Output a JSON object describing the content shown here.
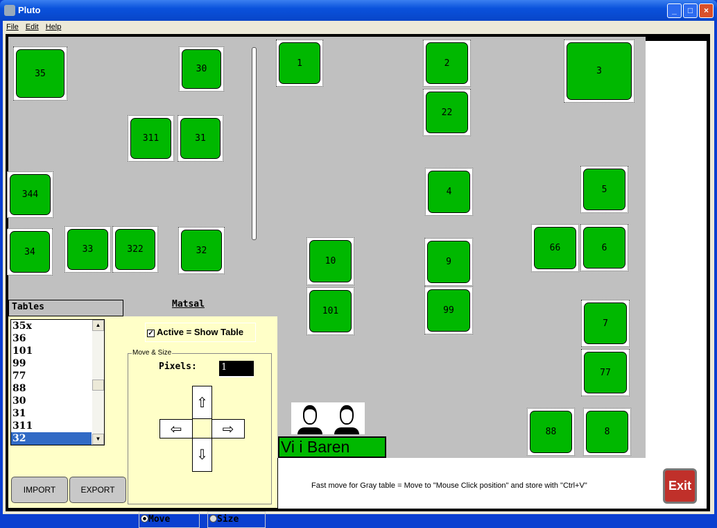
{
  "window": {
    "title": "Pluto",
    "minimize": "_",
    "maximize": "□",
    "close": "×"
  },
  "menu": [
    "File",
    "Edit",
    "Help"
  ],
  "floor": {
    "name": "Matsal",
    "tables": [
      "35",
      "30",
      "1",
      "2",
      "3",
      "22",
      "311",
      "31",
      "344",
      "4",
      "5",
      "34",
      "33",
      "322",
      "32",
      "10",
      "9",
      "66",
      "6",
      "101",
      "99",
      "7",
      "77",
      "88",
      "8"
    ],
    "table_color": "#00b800",
    "bar_label": "Vi i Baren"
  },
  "panel": {
    "header": "Tables",
    "list": [
      "35x",
      "36",
      "101",
      "99",
      "77",
      "88",
      "30",
      "31",
      "311",
      "32"
    ],
    "selected": "32",
    "import": "IMPORT",
    "export": "EXPORT",
    "active_label": "Active = Show Table",
    "active_checked": true,
    "group_label": "Move & Size",
    "pixels_label": "Pixels:",
    "pixels_value": "1",
    "move_label": "Move",
    "size_label": "Size",
    "mode": "Move"
  },
  "hint": "Fast move for Gray table = Move to \"Mouse Click position\" and store with \"Ctrl+V\"",
  "exit": "Exit"
}
